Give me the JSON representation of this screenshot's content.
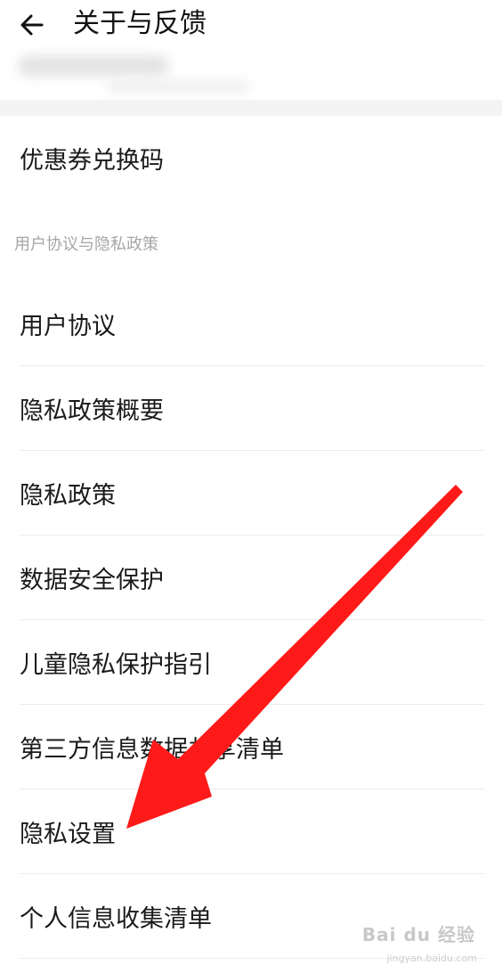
{
  "header": {
    "title": "关于与反馈",
    "back_icon": "back-arrow-icon"
  },
  "coupon_row": {
    "label": "优惠券兑换码"
  },
  "section": {
    "title": "用户协议与隐私政策"
  },
  "items": [
    {
      "label": "用户协议"
    },
    {
      "label": "隐私政策概要"
    },
    {
      "label": "隐私政策"
    },
    {
      "label": "数据安全保护"
    },
    {
      "label": "儿童隐私保护指引"
    },
    {
      "label": "第三方信息数据共享清单"
    },
    {
      "label": "隐私设置"
    },
    {
      "label": "个人信息收集清单"
    }
  ],
  "annotation": {
    "arrow_color": "#ff1a1a"
  },
  "watermark": {
    "brand": "Bai du 经验",
    "url": "jingyan.baidu.com"
  }
}
